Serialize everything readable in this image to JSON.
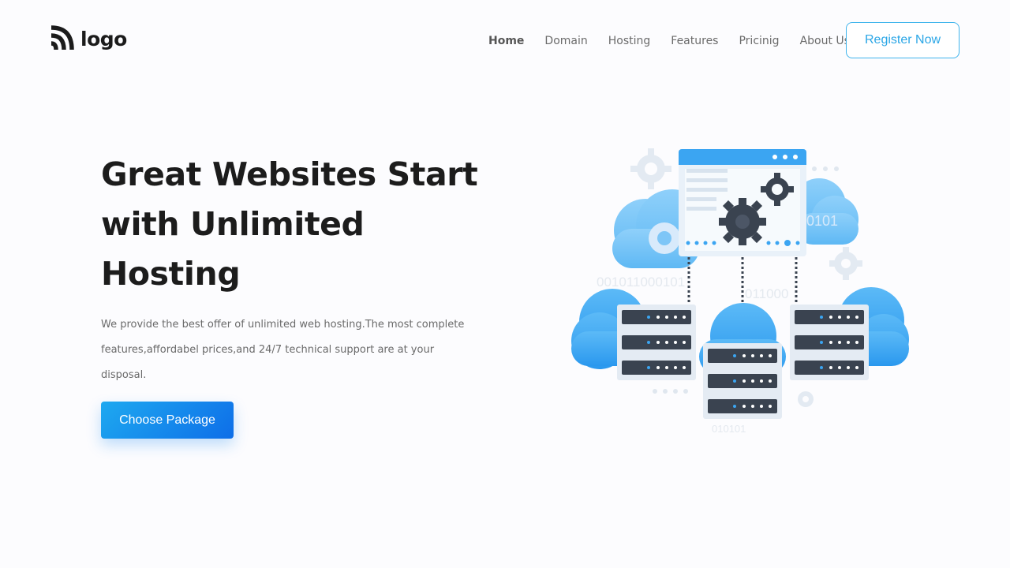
{
  "brand": {
    "logo_text": "logo",
    "logo_icon": "rss-feed-icon"
  },
  "nav": {
    "items": [
      {
        "label": "Home",
        "active": true
      },
      {
        "label": "Domain",
        "active": false
      },
      {
        "label": "Hosting",
        "active": false
      },
      {
        "label": "Features",
        "active": false
      },
      {
        "label": "Pricinig",
        "active": false
      },
      {
        "label": "About Us",
        "active": false
      }
    ],
    "register_label": "Register Now"
  },
  "hero": {
    "title": "Great Websites Start with Unlimited Hosting",
    "description": "We provide the best offer of unlimited web hosting.The most complete features,affordabel prices,and 24/7 technical support are at your disposal.",
    "cta_label": "Choose Package",
    "illustration": {
      "icon": "cloud-servers-illustration",
      "binary_texts": [
        "0101",
        "001011000101",
        "011000",
        "010101"
      ]
    }
  },
  "colors": {
    "accent": "#2aa6e6",
    "button_gradient_start": "#1ea9f0",
    "button_gradient_end": "#0e6ee8",
    "cloud_blue": "#4fb3f6",
    "server_dark": "#3a4350"
  }
}
